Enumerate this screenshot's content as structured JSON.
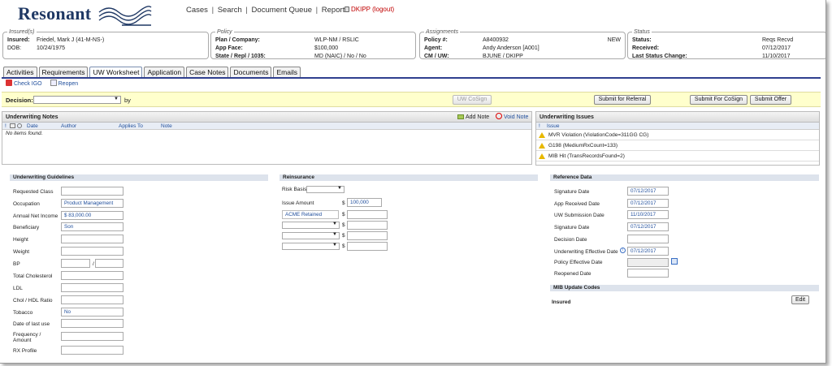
{
  "header": {
    "logo": "Resonant",
    "nav": [
      "Cases",
      "Search",
      "Document Queue",
      "Reports"
    ],
    "user": "DKIPP (logout)"
  },
  "insured": {
    "legend": "Insured(s)",
    "label1": "Insured:",
    "value1": "Friedel, Mark J (41-M-NS-)",
    "label2": "DOB:",
    "value2": "10/24/1975"
  },
  "policy": {
    "legend": "Policy",
    "l1": "Plan / Company:",
    "v1": "WLP-NM / RSLIC",
    "l2": "App Face:",
    "v2": "$100,000",
    "l3": "State / Repl / 1035:",
    "v3": "MD  (NAIC) /  No / No"
  },
  "assignments": {
    "legend": "Assignments",
    "l1": "Policy #:",
    "v1": "A8400932",
    "flag": "NEW",
    "l2": "Agent:",
    "v2": "Andy Anderson [A001]",
    "l3": "CM / UW:",
    "v3": "BJUNE / DKIPP"
  },
  "status": {
    "legend": "Status",
    "l1": "Status:",
    "v1": "Reqs Recvd",
    "l2": "Received:",
    "v2": "07/12/2017",
    "l3": "Last Status Change:",
    "v3": "11/10/2017"
  },
  "tabs": [
    "Activities",
    "Requirements",
    "UW Worksheet",
    "Application",
    "Case Notes",
    "Documents",
    "Emails"
  ],
  "actions": {
    "check": "Check IGO",
    "reopen": "Reopen"
  },
  "decision": {
    "label": "Decision:",
    "by": "by",
    "cosign": "UW CoSign",
    "referral": "Submit for Referral",
    "forcosign": "Submit For CoSign",
    "offer": "Submit Offer"
  },
  "notes": {
    "title": "Underwriting Notes",
    "add": "Add Note",
    "void": "Void Note",
    "cols": [
      "!",
      "Date",
      "Author",
      "Applies To",
      "Note"
    ],
    "empty": "No items found."
  },
  "issues": {
    "title": "Underwriting Issues",
    "col": "Issue",
    "items": [
      "MVR Violation (ViolationCode=311GG CG)",
      "G198 (MediumRxCount=133)",
      "MIB Hit (TransRecordsFound=2)"
    ]
  },
  "guidelines": {
    "title": "Underwriting Guidelines",
    "fields": [
      {
        "label": "Requested Class",
        "value": ""
      },
      {
        "label": "Occupation",
        "value": "Product Management"
      },
      {
        "label": "Annual Net Income",
        "value": "$ 83,000.00"
      },
      {
        "label": "Beneficiary",
        "value": "Son"
      },
      {
        "label": "Height",
        "value": ""
      },
      {
        "label": "Weight",
        "value": ""
      },
      {
        "label": "BP",
        "value": ""
      },
      {
        "label": "Total Cholesterol",
        "value": ""
      },
      {
        "label": "LDL",
        "value": ""
      },
      {
        "label": "Chol / HDL Ratio",
        "value": ""
      },
      {
        "label": "Tobacco",
        "value": "No"
      },
      {
        "label": "Date of last use",
        "value": ""
      },
      {
        "label": "Frequency / Amount",
        "value": ""
      },
      {
        "label": "RX Profile",
        "value": ""
      }
    ],
    "bp_sep": "/"
  },
  "reinsurance": {
    "title": "Reinsurance",
    "risk": "Risk Basis",
    "issue": "Issue Amount",
    "dollar": "$",
    "amount": "100,000",
    "retained": "ACME Retained"
  },
  "reference": {
    "title": "Reference Data",
    "fields": [
      {
        "label": "Signature Date",
        "value": "07/12/2017"
      },
      {
        "label": "App Received Date",
        "value": "07/12/2017"
      },
      {
        "label": "UW Submission Date",
        "value": "11/10/2017"
      },
      {
        "label": "Signature Date",
        "value": "07/12/2017"
      },
      {
        "label": "Decision Date",
        "value": ""
      },
      {
        "label": "Underwriting Effective Date",
        "value": "07/12/2017"
      },
      {
        "label": "Policy Effective Date",
        "value": ""
      },
      {
        "label": "Reopened Date",
        "value": ""
      }
    ],
    "mib_title": "MIB Update Codes",
    "mib_insured": "Insured",
    "edit": "Edit"
  }
}
